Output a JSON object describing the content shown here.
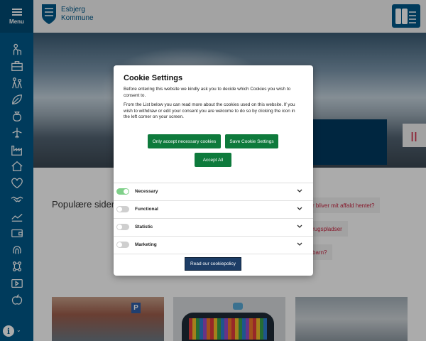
{
  "sidebar": {
    "menu_label": "Menu",
    "icons": [
      "person-icon",
      "briefcase-icon",
      "family-icon",
      "leaf-icon",
      "money-bag-icon",
      "airplane-icon",
      "factory-icon",
      "home-icon",
      "heart-icon",
      "handshake-icon",
      "chart-icon",
      "wallet-icon",
      "fingerprint-icon",
      "network-icon",
      "ticket-icon",
      "apple-icon"
    ],
    "info_icon": "info-icon",
    "info_glyph": "i",
    "info_chevron": "⌄"
  },
  "header": {
    "logo_line1": "Esbjerg",
    "logo_line2": "Kommune",
    "badge_icon": "signature-badge-icon"
  },
  "hero": {
    "pause_glyph": "||"
  },
  "popular": {
    "title": "Populære sider",
    "links": [
      "r bliver mit affald hentet?",
      "rugspladser",
      "barn?"
    ]
  },
  "cards": {
    "parking_sign": "P"
  },
  "cookie_modal": {
    "title": "Cookie Settings",
    "paragraph1": "Before entering this website we kindly ask you to decide which Cookies you wish to consent to.",
    "paragraph2": "From the List below you can read more about the cookies used on this website. If you wish to withdraw or edit your consent you are welcome to do so by clicking the icon in the left corner on your screen.",
    "btn_necessary": "Only accept necessary cookies",
    "btn_save": "Save Cookie Settings",
    "btn_accept": "Accept All",
    "categories": [
      {
        "name": "Necessary",
        "enabled": true
      },
      {
        "name": "Functional",
        "enabled": false
      },
      {
        "name": "Statistic",
        "enabled": false
      },
      {
        "name": "Marketing",
        "enabled": false
      }
    ],
    "btn_policy": "Read our cookiepolicy"
  },
  "colors": {
    "sidebar_blue": "#00598a",
    "accent_green": "#0e7a3c",
    "policy_navy": "#1d3d66",
    "link_red": "#c82540"
  }
}
